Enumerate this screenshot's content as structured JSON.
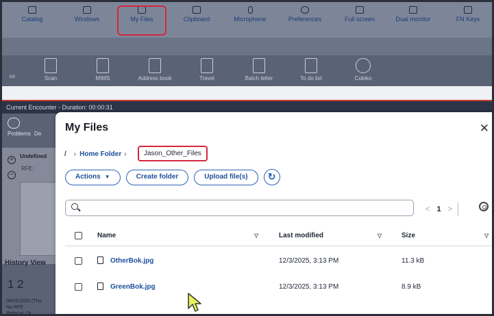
{
  "menubar": {
    "items": [
      {
        "label": "Catalog",
        "icon": "catalog-icon"
      },
      {
        "label": "Windows",
        "icon": "windows-icon"
      },
      {
        "label": "My Files",
        "icon": "folder-icon"
      },
      {
        "label": "Clipboard",
        "icon": "clipboard-icon"
      },
      {
        "label": "Microphone",
        "icon": "microphone-icon"
      },
      {
        "label": "Preferences",
        "icon": "gear-icon"
      },
      {
        "label": "Full screen",
        "icon": "fullscreen-icon"
      },
      {
        "label": "Dual monitor",
        "icon": "dual-monitor-icon"
      },
      {
        "label": "FN Keys",
        "icon": "keyboard-icon"
      }
    ]
  },
  "toolbar": {
    "items": [
      {
        "label": "ox"
      },
      {
        "label": "Scan",
        "icon": "scan-icon"
      },
      {
        "label": "MIMS",
        "icon": "mims-icon"
      },
      {
        "label": "Address book",
        "icon": "address-book-icon"
      },
      {
        "label": "Travel",
        "icon": "airplane-icon"
      },
      {
        "label": "Batch letter",
        "icon": "batch-letter-icon"
      },
      {
        "label": "To do list",
        "icon": "todo-icon"
      },
      {
        "label": "Cubiko",
        "icon": "cubiko-icon"
      }
    ]
  },
  "encounter": {
    "label": "Current Encounter - Duration: 00:00:31"
  },
  "leftpanel": {
    "problems": "Problems",
    "de": "De",
    "undefined": "Undefined",
    "rfe": "RFE:",
    "history": "History View",
    "nums": "1 2",
    "date": "08/05/2025 (Thu",
    "no_rfe": "No RFE",
    "referral": "Referral: Dr"
  },
  "dialog": {
    "title": "My Files",
    "close": "✕",
    "breadcrumb": {
      "root": "/",
      "home": "Home Folder",
      "current": "Jason_Other_Files"
    },
    "buttons": {
      "actions": "Actions",
      "create_folder": "Create folder",
      "upload": "Upload file(s)"
    },
    "search_placeholder": "",
    "pager": {
      "prev": "<",
      "page": "1",
      "next": ">"
    },
    "table": {
      "headers": {
        "name": "Name",
        "modified": "Last modified",
        "size": "Size"
      },
      "rows": [
        {
          "name": "OtherBok.jpg",
          "modified": "12/3/2025, 3:13 PM",
          "size": "11.3 kB"
        },
        {
          "name": "GreenBok.jpg",
          "modified": "12/3/2025, 3:13 PM",
          "size": "8.9 kB"
        }
      ]
    }
  },
  "colors": {
    "accent": "#2a62b8",
    "highlight": "#d7263d",
    "menubar": "#7d8699"
  }
}
